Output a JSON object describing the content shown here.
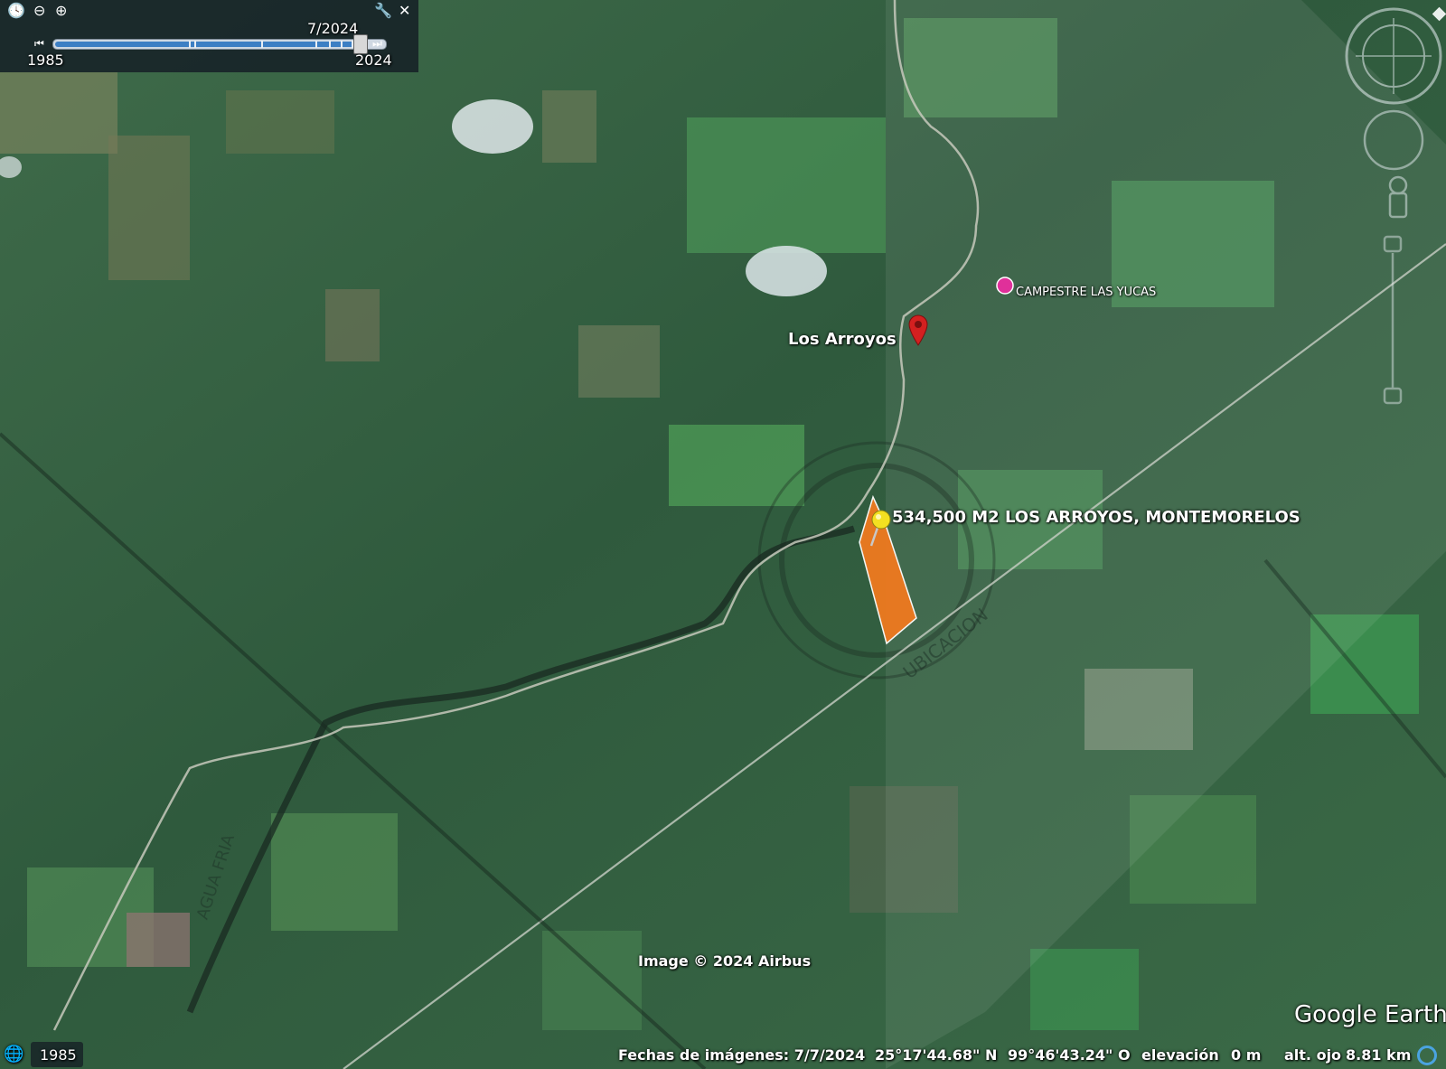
{
  "timebar": {
    "start_year": "1985",
    "end_year": "2024",
    "current_date": "7/2024",
    "position": 0.93
  },
  "map": {
    "place_label": "Los Arroyos",
    "poi_label": "CAMPESTRE LAS YUCAS",
    "parcel_label": "534,500 M2 LOS ARROYOS, MONTEMORELOS",
    "stamp_text": "UBICACION",
    "road_label": "AGUA FRIA",
    "attribution": "Image © 2024 Airbus",
    "logo": "Google Earth",
    "colors": {
      "parcel": "#f07a1f",
      "pin_red": "#d42020",
      "poi_pink": "#e0309a",
      "pushpin": "#f4e021"
    }
  },
  "statusbar": {
    "history_year": "1985",
    "imagery_date": "Fechas de imágenes: 7/7/2024",
    "lat": "25°17'44.68\" N",
    "lon": "99°46'43.24\" O",
    "elev_label": "elevación",
    "elev_value": "0 m",
    "eye_label": "alt. ojo",
    "eye_value": "8.81 km"
  },
  "icons": [
    "clock-icon",
    "zoom-out-icon",
    "zoom-in-icon",
    "wrench-icon",
    "close-icon",
    "compass-icon",
    "look-joystick-icon",
    "pegman-icon",
    "zoom-slider-icon",
    "globe-icon",
    "streaming-icon"
  ]
}
